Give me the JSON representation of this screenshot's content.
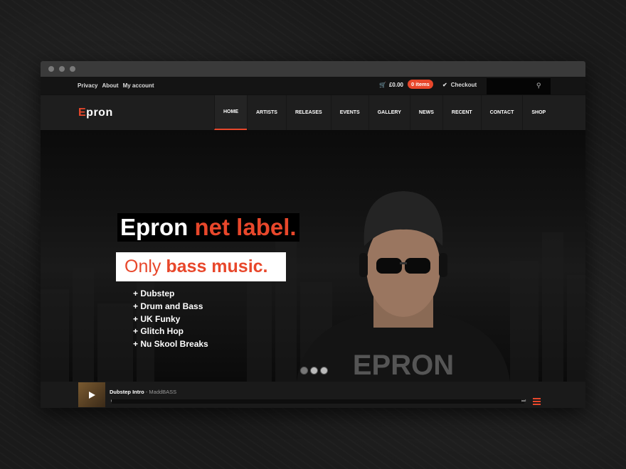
{
  "topbar": {
    "links": [
      "Privacy",
      "About",
      "My account"
    ],
    "cart_total": "£0.00",
    "cart_items": "0 items",
    "checkout": "Checkout",
    "search_placeholder": ""
  },
  "brand": {
    "logo_e": "E",
    "logo_rest": "pron"
  },
  "nav": [
    "HOME",
    "ARTISTS",
    "RELEASES",
    "EVENTS",
    "GALLERY",
    "NEWS",
    "RECENT",
    "CONTACT",
    "SHOP"
  ],
  "hero": {
    "headline_main": "Epron",
    "headline_accent": "net label.",
    "sub_main": "Only",
    "sub_bold": "bass music.",
    "genres": [
      "+ Dubstep",
      "+ Drum and Bass",
      "+ UK Funky",
      "+ Glitch Hop",
      "+ Nu Skool Breaks"
    ],
    "shirt_text": "EPRON",
    "slide_count": 3,
    "active_slide": 0
  },
  "player": {
    "track": "Dubstep Intro",
    "artist": " - MaddBASS"
  },
  "colors": {
    "accent": "#e8472b",
    "background": "#151515"
  }
}
